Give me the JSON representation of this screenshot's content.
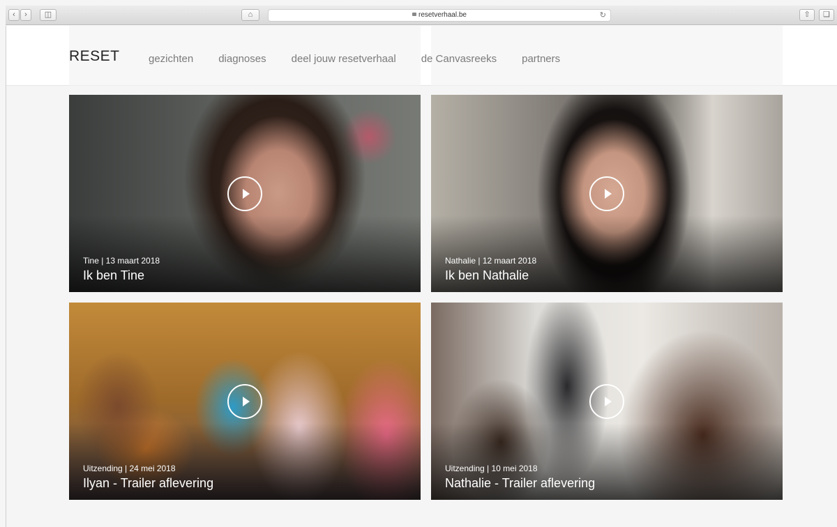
{
  "browser": {
    "url": "resetverhaal.be"
  },
  "header": {
    "logo": "RESET",
    "nav": [
      "gezichten",
      "diagnoses",
      "deel jouw resetverhaal",
      "de Canvasreeks",
      "partners"
    ]
  },
  "cards": [
    {
      "meta": "Tine | 13 maart 2018",
      "title": "Ik ben Tine"
    },
    {
      "meta": "Nathalie | 12 maart 2018",
      "title": "Ik ben Nathalie"
    },
    {
      "meta": "Uitzending | 24 mei 2018",
      "title": "Ilyan - Trailer aflevering"
    },
    {
      "meta": "Uitzending | 10 mei 2018",
      "title": "Nathalie - Trailer aflevering"
    }
  ]
}
